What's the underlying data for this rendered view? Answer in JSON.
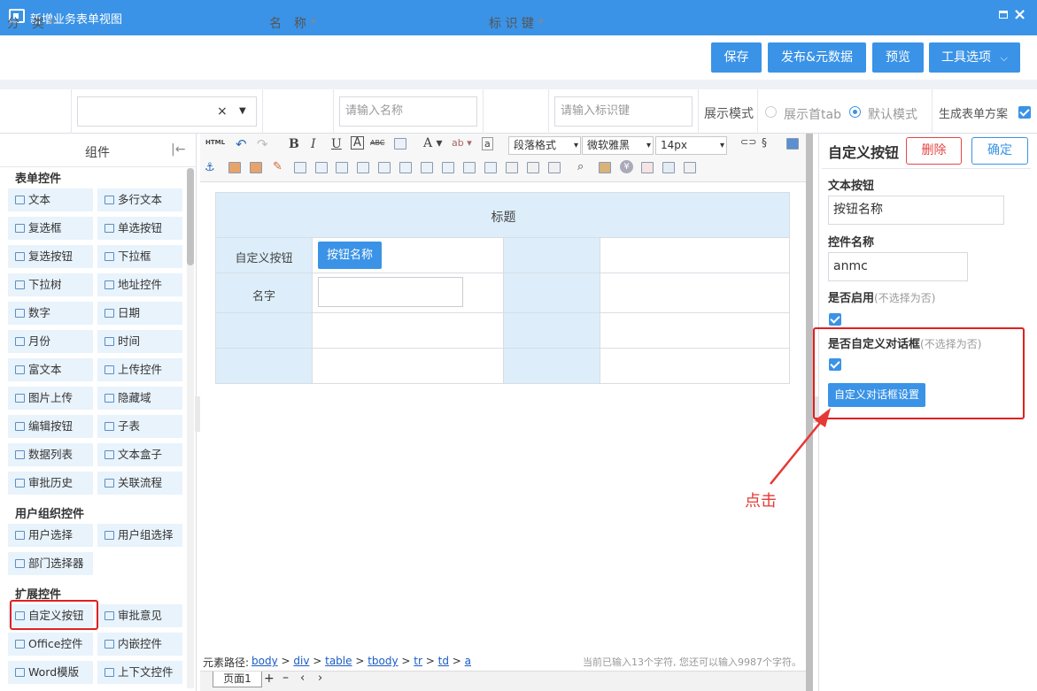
{
  "window": {
    "title": "新增业务表单视图"
  },
  "top_buttons": {
    "save": "保存",
    "publish": "发布&元数据",
    "preview": "预览",
    "tools": "工具选项"
  },
  "form": {
    "category_label": "分　类",
    "category_value": "",
    "name_label": "名　称",
    "name_placeholder": "请输入名称",
    "key_label": "标 识 键",
    "key_placeholder": "请输入标识键",
    "required_mark": "*",
    "display_mode_label": "展示模式",
    "mode_first_tab": "展示首tab",
    "mode_default": "默认模式",
    "gen_scheme_label": "生成表单方案"
  },
  "components": {
    "header": "组件",
    "sections": [
      {
        "title": "表单控件",
        "items": [
          "文本",
          "多行文本",
          "复选框",
          "单选按钮",
          "复选按钮",
          "下拉框",
          "下拉树",
          "地址控件",
          "数字",
          "日期",
          "月份",
          "时间",
          "富文本",
          "上传控件",
          "图片上传",
          "隐藏域",
          "编辑按钮",
          "子表",
          "数据列表",
          "文本盒子",
          "审批历史",
          "关联流程"
        ]
      },
      {
        "title": "用户组织控件",
        "items": [
          "用户选择",
          "用户组选择",
          "部门选择器"
        ]
      },
      {
        "title": "扩展控件",
        "items": [
          "自定义按钮",
          "审批意见",
          "Office控件",
          "内嵌控件",
          "Word模版",
          "上下文控件"
        ]
      }
    ]
  },
  "editor": {
    "toolbar": {
      "html": "HTML",
      "paragraph": "段落格式",
      "font": "微软雅黑",
      "size": "14px"
    },
    "table": {
      "title": "标题",
      "row1_label": "自定义按钮",
      "row1_button": "按钮名称",
      "row2_label": "名字"
    },
    "path_label": "元素路径:",
    "path": [
      "body",
      "div",
      "table",
      "tbody",
      "tr",
      "td",
      "a"
    ],
    "char_count": "当前已输入13个字符, 您还可以输入9987个字符。",
    "page_tab": "页面1"
  },
  "properties": {
    "title": "自定义按钮",
    "delete": "删除",
    "confirm": "确定",
    "text_label": "文本按钮",
    "text_value": "按钮名称",
    "name_label": "控件名称",
    "name_value": "anmc",
    "enable_label": "是否启用",
    "enable_hint": "(不选择为否)",
    "custom_dialog_label": "是否自定义对话框",
    "custom_dialog_hint": "(不选择为否)",
    "dialog_settings": "自定义对话框设置"
  },
  "annotation": {
    "text": "点击",
    "color": "#e53935"
  },
  "colors": {
    "primary": "#3a93e6",
    "danger": "#e64545",
    "light_blue": "#ddeefa"
  }
}
